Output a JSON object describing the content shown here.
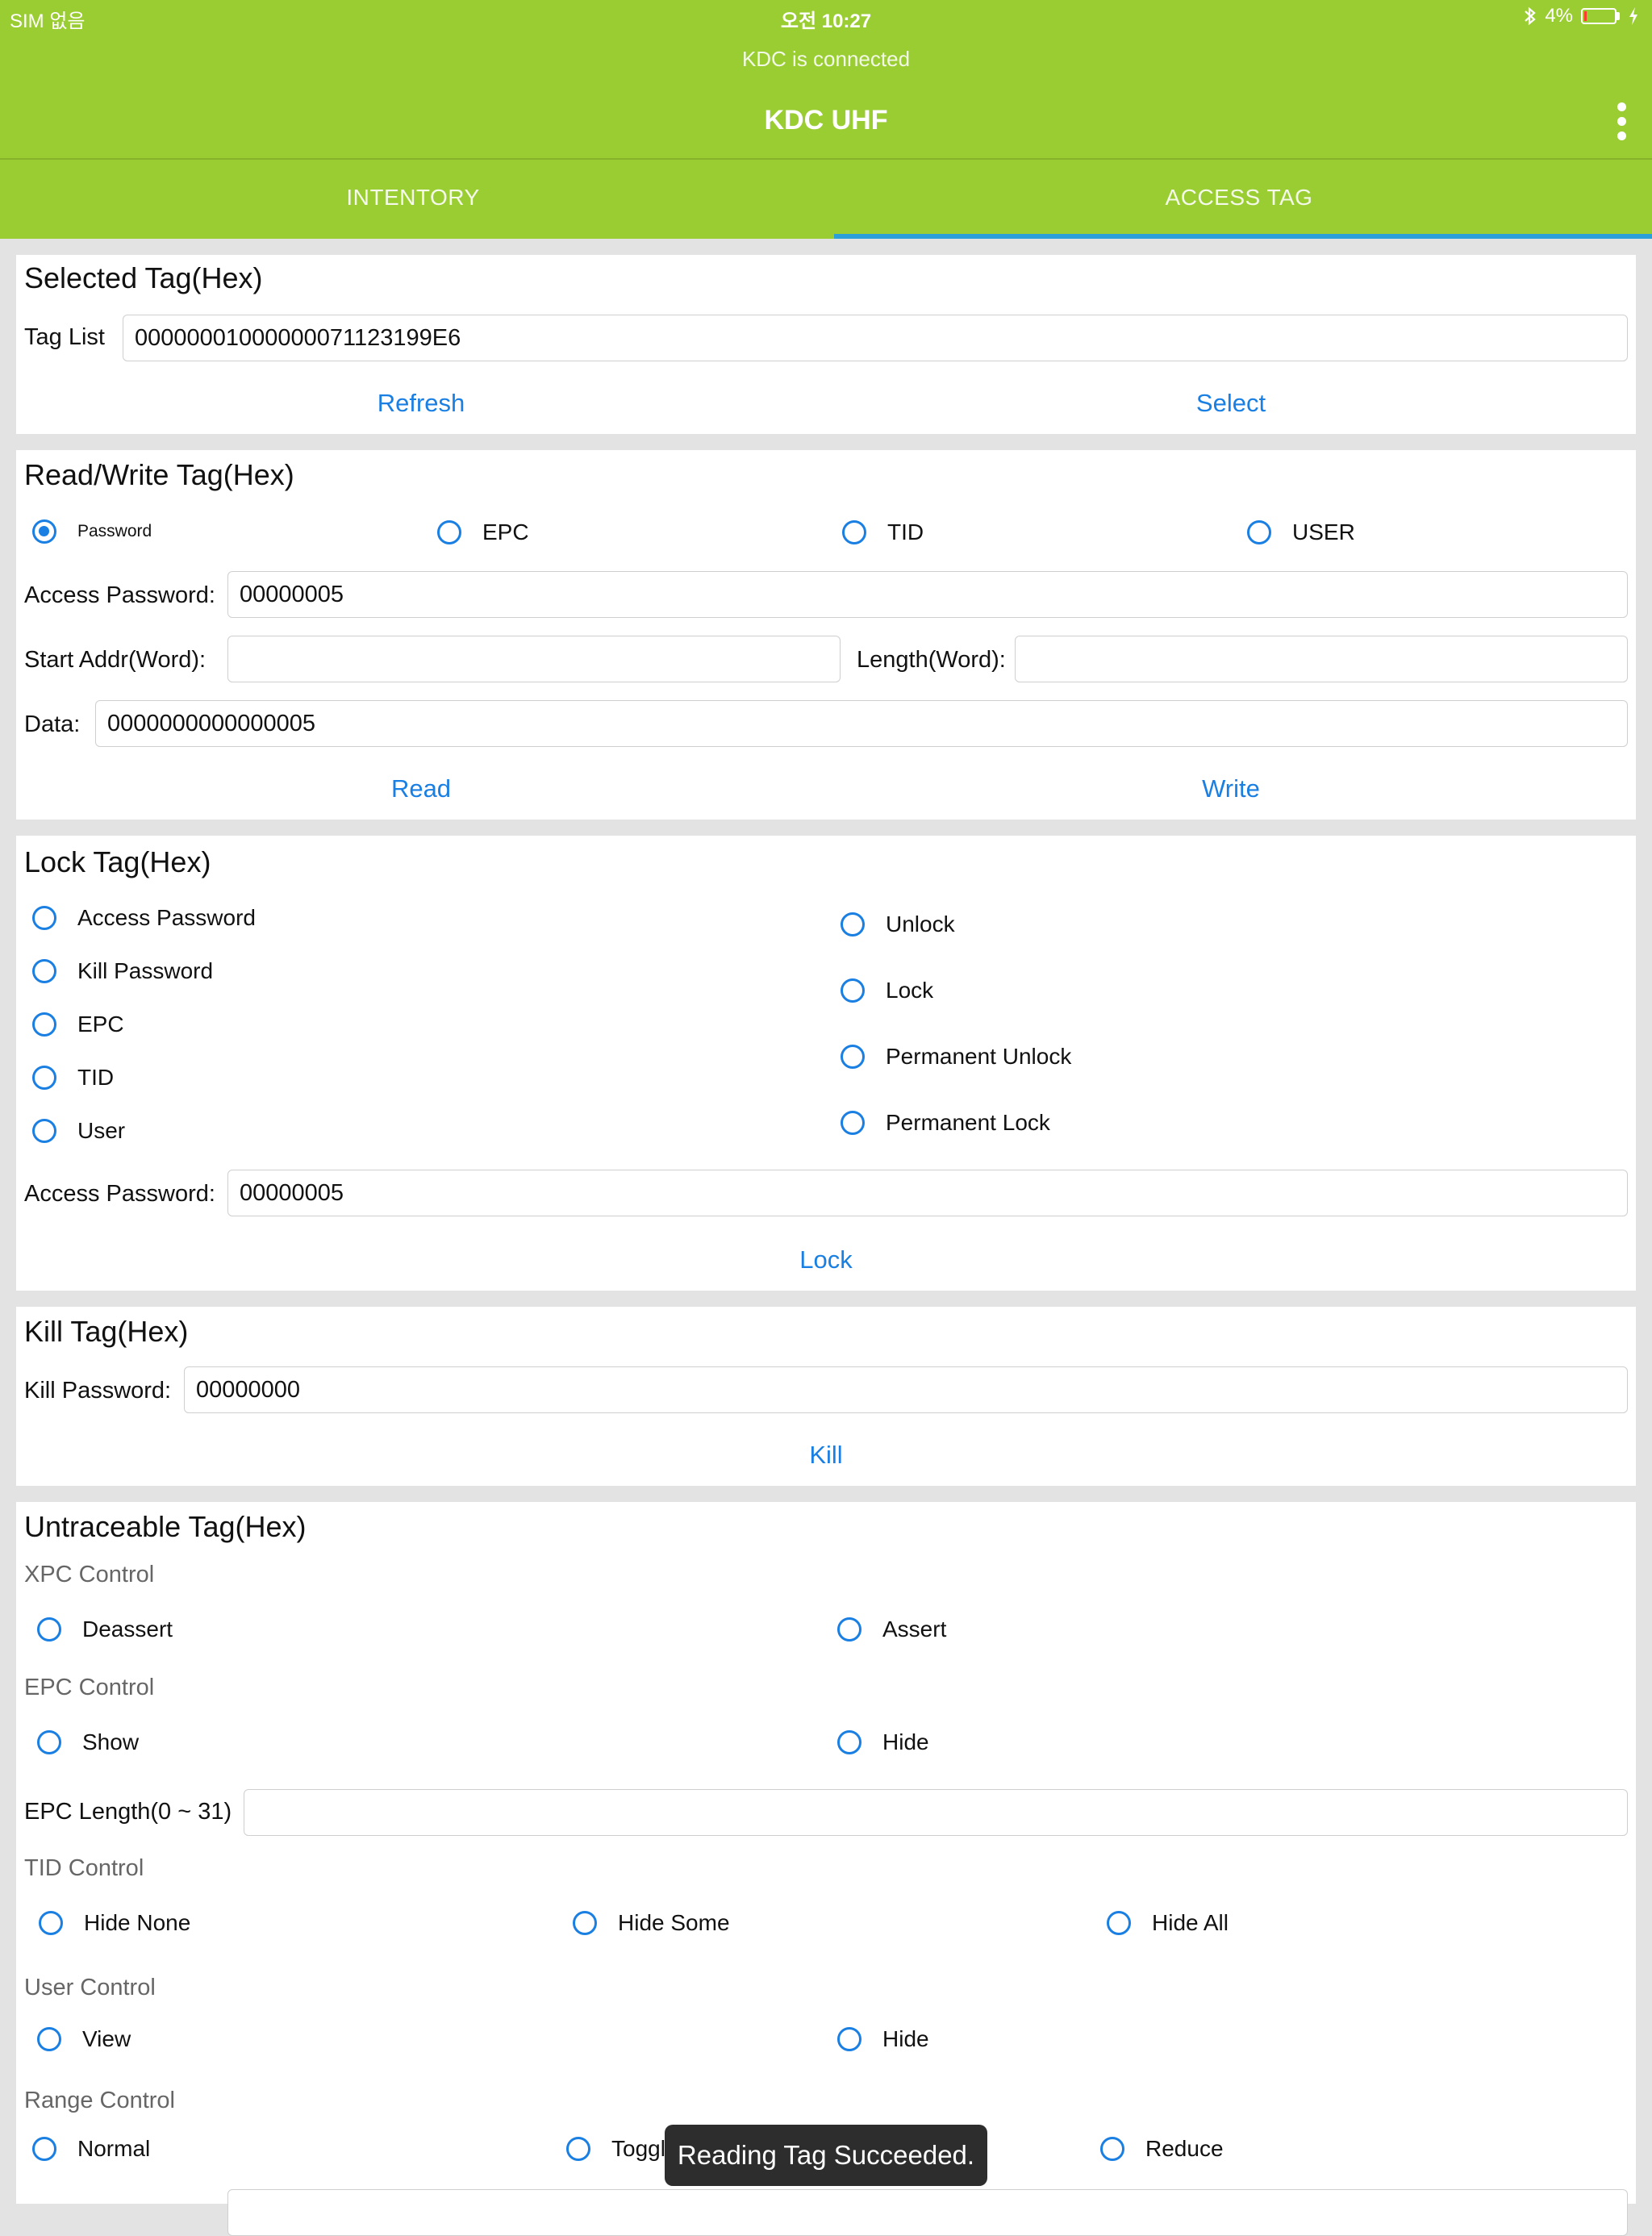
{
  "status_bar": {
    "carrier": "SIM 없음",
    "time": "오전 10:27",
    "battery_text": "4%",
    "battery_level": 0.04
  },
  "header": {
    "connection_status": "KDC is connected",
    "title": "KDC UHF"
  },
  "tabs": [
    {
      "label": "INTENTORY",
      "selected": false
    },
    {
      "label": "ACCESS TAG",
      "selected": true
    }
  ],
  "selected_tag": {
    "title": "Selected Tag(Hex)",
    "tag_list_label": "Tag List",
    "tag_list_value": "00000001000000071123199E6",
    "refresh_label": "Refresh",
    "select_label": "Select"
  },
  "read_write": {
    "title": "Read/Write Tag(Hex)",
    "banks": [
      {
        "label": "Password",
        "selected": true
      },
      {
        "label": "EPC",
        "selected": false
      },
      {
        "label": "TID",
        "selected": false
      },
      {
        "label": "USER",
        "selected": false
      }
    ],
    "access_password_label": "Access Password:",
    "access_password_value": "00000005",
    "start_addr_label": "Start Addr(Word):",
    "start_addr_value": "",
    "length_label": "Length(Word):",
    "length_value": "",
    "data_label": "Data:",
    "data_value": "0000000000000005",
    "read_label": "Read",
    "write_label": "Write"
  },
  "lock_tag": {
    "title": "Lock Tag(Hex)",
    "targets": [
      "Access Password",
      "Kill Password",
      "EPC",
      "TID",
      "User"
    ],
    "actions": [
      "Unlock",
      "Lock",
      "Permanent Unlock",
      "Permanent Lock"
    ],
    "access_password_label": "Access Password:",
    "access_password_value": "00000005",
    "lock_label": "Lock"
  },
  "kill_tag": {
    "title": "Kill Tag(Hex)",
    "kill_password_label": "Kill Password:",
    "kill_password_value": "00000000",
    "kill_label": "Kill"
  },
  "untraceable": {
    "title": "Untraceable Tag(Hex)",
    "xpc_label": "XPC Control",
    "xpc_options": [
      "Deassert",
      "Assert"
    ],
    "epc_label": "EPC Control",
    "epc_options": [
      "Show",
      "Hide"
    ],
    "epc_length_label": "EPC Length(0 ~ 31)",
    "epc_length_value": "",
    "tid_label": "TID Control",
    "tid_options": [
      "Hide None",
      "Hide Some",
      "Hide All"
    ],
    "user_label": "User Control",
    "user_options": [
      "View",
      "Hide"
    ],
    "range_label": "Range Control",
    "range_options": [
      "Normal",
      "Toggle",
      "Reduce"
    ]
  },
  "toast": {
    "message": "Reading Tag Succeeded."
  }
}
